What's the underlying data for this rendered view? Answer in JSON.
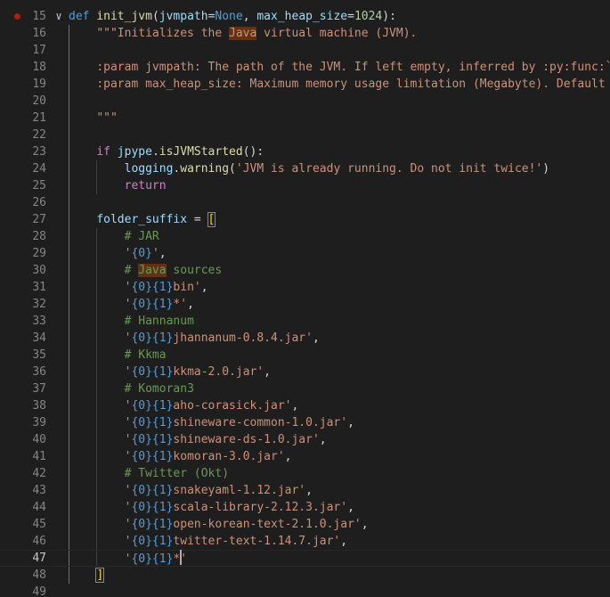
{
  "editor": {
    "current_line": 47,
    "breakpoint_line": 15,
    "lines": [
      {
        "n": 15,
        "tokens": [
          [
            "kw",
            "def "
          ],
          [
            "fn",
            "init_jvm"
          ],
          [
            "plain",
            "("
          ],
          [
            "param",
            "jvmpath"
          ],
          [
            "op",
            "="
          ],
          [
            "const",
            "None"
          ],
          [
            "plain",
            ", "
          ],
          [
            "param",
            "max_heap_size"
          ],
          [
            "op",
            "="
          ],
          [
            "num",
            "1024"
          ],
          [
            "plain",
            "):"
          ]
        ]
      },
      {
        "n": 16,
        "tokens": [
          [
            "plain",
            "    "
          ],
          [
            "str",
            "\"\"\"Initializes the "
          ],
          [
            "strhl",
            "Java"
          ],
          [
            "str",
            " virtual machine (JVM)."
          ]
        ]
      },
      {
        "n": 17,
        "tokens": []
      },
      {
        "n": 18,
        "tokens": [
          [
            "plain",
            "    "
          ],
          [
            "str",
            ":param jvmpath: The path of the JVM. If left empty, inferred by :py:func:`j"
          ]
        ]
      },
      {
        "n": 19,
        "tokens": [
          [
            "plain",
            "    "
          ],
          [
            "str",
            ":param max_heap_size: Maximum memory usage limitation (Megabyte). Default i"
          ]
        ]
      },
      {
        "n": 20,
        "tokens": []
      },
      {
        "n": 21,
        "tokens": [
          [
            "plain",
            "    "
          ],
          [
            "str",
            "\"\"\""
          ]
        ]
      },
      {
        "n": 22,
        "tokens": []
      },
      {
        "n": 23,
        "tokens": [
          [
            "plain",
            "    "
          ],
          [
            "ctrl",
            "if "
          ],
          [
            "var",
            "jpype"
          ],
          [
            "plain",
            "."
          ],
          [
            "fn",
            "isJVMStarted"
          ],
          [
            "plain",
            "():"
          ]
        ]
      },
      {
        "n": 24,
        "tokens": [
          [
            "plain",
            "        "
          ],
          [
            "var",
            "logging"
          ],
          [
            "plain",
            "."
          ],
          [
            "fn",
            "warning"
          ],
          [
            "plain",
            "("
          ],
          [
            "str",
            "'JVM is already running. Do not init twice!'"
          ],
          [
            "plain",
            ")"
          ]
        ]
      },
      {
        "n": 25,
        "tokens": [
          [
            "plain",
            "        "
          ],
          [
            "ctrl",
            "return"
          ]
        ]
      },
      {
        "n": 26,
        "tokens": []
      },
      {
        "n": 27,
        "tokens": [
          [
            "plain",
            "    "
          ],
          [
            "var",
            "folder_suffix"
          ],
          [
            "plain",
            " = "
          ],
          [
            "brsel",
            "["
          ]
        ]
      },
      {
        "n": 28,
        "tokens": [
          [
            "plain",
            "        "
          ],
          [
            "com",
            "# JAR"
          ]
        ]
      },
      {
        "n": 29,
        "tokens": [
          [
            "plain",
            "        "
          ],
          [
            "str",
            "'"
          ],
          [
            "ph",
            "{0}"
          ],
          [
            "str",
            "'"
          ],
          [
            "plain",
            ","
          ]
        ]
      },
      {
        "n": 30,
        "tokens": [
          [
            "plain",
            "        "
          ],
          [
            "com",
            "# "
          ],
          [
            "comhl",
            "Java"
          ],
          [
            "com",
            " sources"
          ]
        ]
      },
      {
        "n": 31,
        "tokens": [
          [
            "plain",
            "        "
          ],
          [
            "str",
            "'"
          ],
          [
            "ph",
            "{0}{1}"
          ],
          [
            "str",
            "bin'"
          ],
          [
            "plain",
            ","
          ]
        ]
      },
      {
        "n": 32,
        "tokens": [
          [
            "plain",
            "        "
          ],
          [
            "str",
            "'"
          ],
          [
            "ph",
            "{0}{1}"
          ],
          [
            "str",
            "*'"
          ],
          [
            "plain",
            ","
          ]
        ]
      },
      {
        "n": 33,
        "tokens": [
          [
            "plain",
            "        "
          ],
          [
            "com",
            "# Hannanum"
          ]
        ]
      },
      {
        "n": 34,
        "tokens": [
          [
            "plain",
            "        "
          ],
          [
            "str",
            "'"
          ],
          [
            "ph",
            "{0}{1}"
          ],
          [
            "str",
            "jhannanum-0.8.4.jar'"
          ],
          [
            "plain",
            ","
          ]
        ]
      },
      {
        "n": 35,
        "tokens": [
          [
            "plain",
            "        "
          ],
          [
            "com",
            "# Kkma"
          ]
        ]
      },
      {
        "n": 36,
        "tokens": [
          [
            "plain",
            "        "
          ],
          [
            "str",
            "'"
          ],
          [
            "ph",
            "{0}{1}"
          ],
          [
            "str",
            "kkma-2.0.jar'"
          ],
          [
            "plain",
            ","
          ]
        ]
      },
      {
        "n": 37,
        "tokens": [
          [
            "plain",
            "        "
          ],
          [
            "com",
            "# Komoran3"
          ]
        ]
      },
      {
        "n": 38,
        "tokens": [
          [
            "plain",
            "        "
          ],
          [
            "str",
            "'"
          ],
          [
            "ph",
            "{0}{1}"
          ],
          [
            "str",
            "aho-corasick.jar'"
          ],
          [
            "plain",
            ","
          ]
        ]
      },
      {
        "n": 39,
        "tokens": [
          [
            "plain",
            "        "
          ],
          [
            "str",
            "'"
          ],
          [
            "ph",
            "{0}{1}"
          ],
          [
            "str",
            "shineware-common-1.0.jar'"
          ],
          [
            "plain",
            ","
          ]
        ]
      },
      {
        "n": 40,
        "tokens": [
          [
            "plain",
            "        "
          ],
          [
            "str",
            "'"
          ],
          [
            "ph",
            "{0}{1}"
          ],
          [
            "str",
            "shineware-ds-1.0.jar'"
          ],
          [
            "plain",
            ","
          ]
        ]
      },
      {
        "n": 41,
        "tokens": [
          [
            "plain",
            "        "
          ],
          [
            "str",
            "'"
          ],
          [
            "ph",
            "{0}{1}"
          ],
          [
            "str",
            "komoran-3.0.jar'"
          ],
          [
            "plain",
            ","
          ]
        ]
      },
      {
        "n": 42,
        "tokens": [
          [
            "plain",
            "        "
          ],
          [
            "com",
            "# Twitter (Okt)"
          ]
        ]
      },
      {
        "n": 43,
        "tokens": [
          [
            "plain",
            "        "
          ],
          [
            "str",
            "'"
          ],
          [
            "ph",
            "{0}{1}"
          ],
          [
            "str",
            "snakeyaml-1.12.jar'"
          ],
          [
            "plain",
            ","
          ]
        ]
      },
      {
        "n": 44,
        "tokens": [
          [
            "plain",
            "        "
          ],
          [
            "str",
            "'"
          ],
          [
            "ph",
            "{0}{1}"
          ],
          [
            "str",
            "scala-library-2.12.3.jar'"
          ],
          [
            "plain",
            ","
          ]
        ]
      },
      {
        "n": 45,
        "tokens": [
          [
            "plain",
            "        "
          ],
          [
            "str",
            "'"
          ],
          [
            "ph",
            "{0}{1}"
          ],
          [
            "str",
            "open-korean-text-2.1.0.jar'"
          ],
          [
            "plain",
            ","
          ]
        ]
      },
      {
        "n": 46,
        "tokens": [
          [
            "plain",
            "        "
          ],
          [
            "str",
            "'"
          ],
          [
            "ph",
            "{0}{1}"
          ],
          [
            "str",
            "twitter-text-1.14.7.jar'"
          ],
          [
            "plain",
            ","
          ]
        ]
      },
      {
        "n": 47,
        "tokens": [
          [
            "plain",
            "        "
          ],
          [
            "str",
            "'"
          ],
          [
            "ph",
            "{0}{1}"
          ],
          [
            "str",
            "*"
          ],
          [
            "cursor",
            ""
          ],
          [
            "str",
            "'"
          ]
        ]
      },
      {
        "n": 48,
        "tokens": [
          [
            "plain",
            "    "
          ],
          [
            "brsel",
            "]"
          ]
        ]
      },
      {
        "n": 49,
        "tokens": []
      }
    ]
  },
  "icons": {
    "fold": "chevron-down-icon",
    "breakpoint": "breakpoint-dot-icon"
  }
}
